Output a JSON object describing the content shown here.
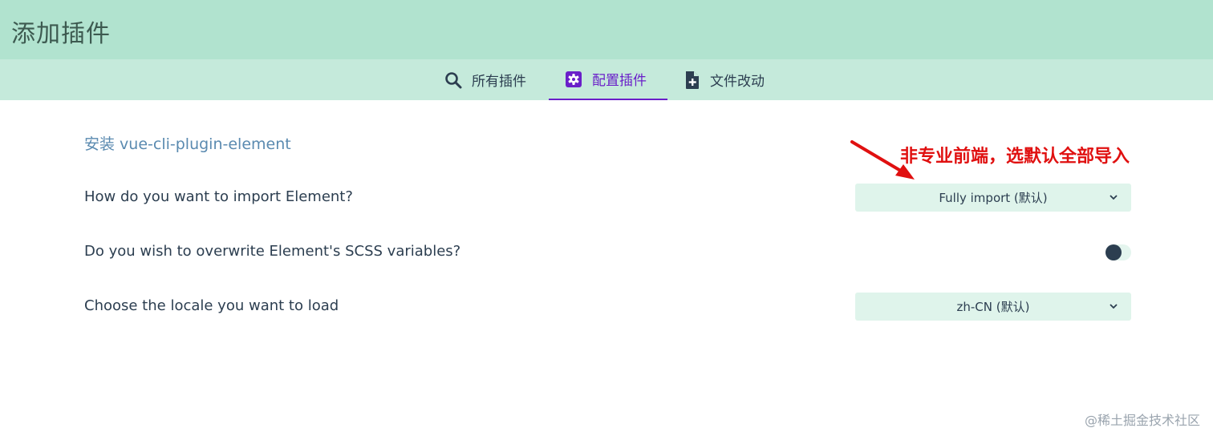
{
  "window": {
    "title": "添加插件"
  },
  "tabs": [
    {
      "label": "所有插件",
      "icon": "search-icon",
      "active": false
    },
    {
      "label": "配置插件",
      "icon": "gear-icon",
      "active": true
    },
    {
      "label": "文件改动",
      "icon": "file-add-icon",
      "active": false
    }
  ],
  "main": {
    "section_title": "安装 vue-cli-plugin-element",
    "annotation": "非专业前端，选默认全部导入",
    "questions": [
      {
        "label": "How do you want to import Element?",
        "type": "select",
        "value": "Fully import (默认)"
      },
      {
        "label": "Do you wish to overwrite Element's SCSS variables?",
        "type": "toggle",
        "value": false
      },
      {
        "label": "Choose the locale you want to load",
        "type": "select",
        "value": "zh-CN (默认)"
      }
    ]
  },
  "watermark": "@稀土掘金技术社区",
  "colors": {
    "header_bg": "#b1e3cf",
    "tabbar_bg": "#c5eadb",
    "accent": "#6a1fc9",
    "annotation": "#e01010",
    "select_bg": "#dff4eb"
  }
}
